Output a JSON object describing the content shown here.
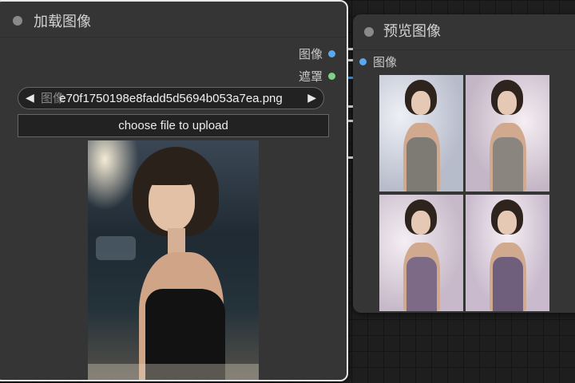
{
  "colors": {
    "canvas_bg": "#1e1e1e",
    "node_bg": "#353535",
    "image_slot": "#5aa9ef",
    "mask_slot": "#7ed37e",
    "selected_border": "#e8e8e8"
  },
  "load_image_node": {
    "title": "加载图像",
    "outputs": [
      {
        "label": "图像",
        "color": "#5aa9ef"
      },
      {
        "label": "遮罩",
        "color": "#7ed37e"
      }
    ],
    "image_widget": {
      "label": "图像",
      "value": "e70f1750198e8fadd5d5694b053a7ea.png",
      "prev_icon": "◀",
      "next_icon": "▶"
    },
    "upload_button": "choose file to upload"
  },
  "preview_image_node": {
    "title": "预览图像",
    "input": {
      "label": "图像",
      "color": "#5aa9ef"
    },
    "thumbnail_count": 4
  }
}
